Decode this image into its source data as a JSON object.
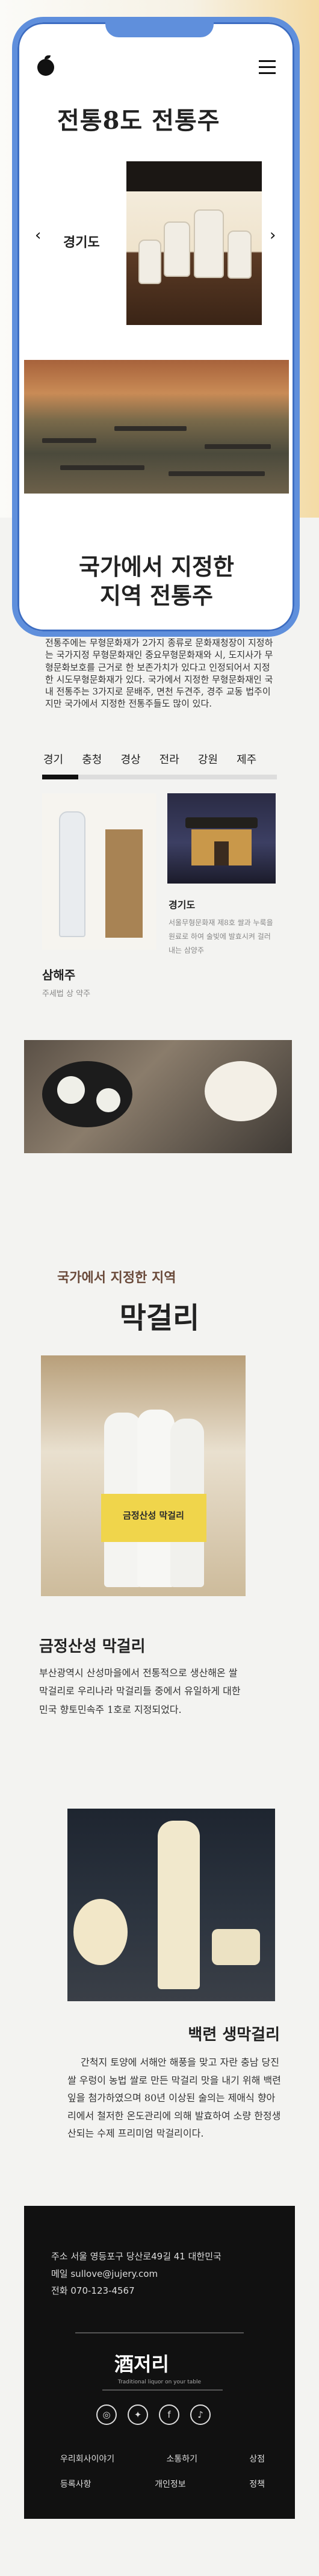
{
  "header": {
    "title": "전통8도 전통주"
  },
  "slider": {
    "region": "경기도",
    "prev_icon": "chevron-left",
    "next_icon": "chevron-right"
  },
  "designated": {
    "heading_line1": "국가에서 지정한",
    "heading_line2": "지역 전통주",
    "description": "전통주에는 무형문화재가 2가지 종류로 문화재청장이 지정하는 국가지정 무형문화재인 중요무형문화재와 시, 도지사가 무형문화보호를 근거로 한 보존가치가 있다고 인정되어서 지정한 시도무형문화재가 있다. 국가에서 지정한 무형문화재인 국내 전통주는 3가지로 문배주, 면천 두견주, 경주 교동 법주이지만 국가에서 지정한 전통주들도 많이 있다.",
    "tabs": [
      "경기",
      "충청",
      "경상",
      "전라",
      "강원",
      "제주"
    ],
    "products": [
      {
        "name": "삼해주",
        "meta": "주세법 상 약주"
      },
      {
        "name": "경기도",
        "meta": "서울무형문화재 제8호 쌀과 누룩을 원료로 하여 술빚에 발효시켜 걸러내는 삼양주"
      }
    ]
  },
  "makgeolli": {
    "subtitle": "국가에서 지정한 지역",
    "title": "막걸리",
    "items": [
      {
        "name": "금정산성 막걸리",
        "desc": "부산광역시 산성마을에서 전통적으로 생산해온 쌀 막걸리로 우리나라 막걸리들 중에서 유일하게 대한민국 향토민속주 1호로 지정되었다.",
        "bottle_label": "금정산성 막걸리"
      },
      {
        "name": "백련 생막걸리",
        "desc": "간척지 토양에 서해안 해풍을 맞고 자란 충남 당진 쌀 우렁이 농법 쌀로 만든 막걸리 맛을 내기 위해 백련잎을 첨가하였으며 80년 이상된 술의는 제애식 향아리에서 철저한 온도관리에 의해 발효하여 소량 한정생산되는 수제 프리미엄 막걸리이다."
      }
    ]
  },
  "footer": {
    "address": "주소 서울 영등포구 당산로49길 41 대한민국",
    "email": "메일 sullove@jujery.com",
    "phone": "전화 070-123-4567",
    "logo_han": "酒",
    "logo_text": "저리",
    "logo_sub": "Traditional liquor on your table",
    "social": [
      "instagram-icon",
      "twitter-icon",
      "facebook-icon",
      "tiktok-icon"
    ],
    "links": [
      [
        "우리회사이야기",
        "소통하기",
        "상점"
      ],
      [
        "등록사항",
        "개인정보",
        "정책"
      ]
    ],
    "colors": {
      "frame": "#5f8fdc",
      "footer_bg": "#111111",
      "accent": "#f4dba5"
    }
  }
}
